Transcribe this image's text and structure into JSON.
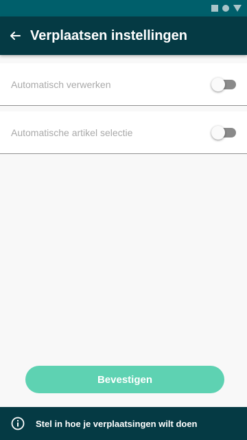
{
  "status_bar": {
    "icons": [
      "square-icon",
      "circle-icon",
      "triangle-icon"
    ],
    "color": "#005f6b"
  },
  "app_bar": {
    "back_icon": "arrow-left-icon",
    "title": "Verplaatsen instellingen",
    "color": "#053a44"
  },
  "settings": [
    {
      "label": "Automatisch verwerken",
      "enabled": false
    },
    {
      "label": "Automatische artikel selectie",
      "enabled": false
    }
  ],
  "confirm_button": {
    "label": "Bevestigen",
    "color": "#5ed2b2"
  },
  "info_bar": {
    "icon": "info-icon",
    "text": "Stel in hoe je verplaatsingen wilt doen"
  }
}
